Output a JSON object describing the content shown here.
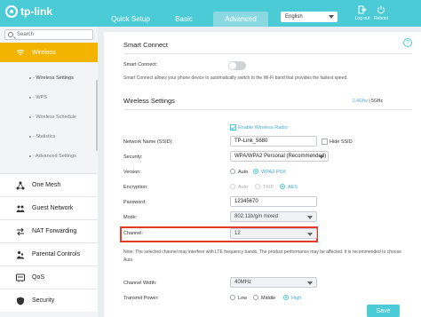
{
  "header": {
    "brand": "tp-link",
    "tabs": [
      {
        "label": "Quick Setup"
      },
      {
        "label": "Basic"
      },
      {
        "label": "Advanced"
      }
    ],
    "language": "English",
    "logout_label": "Log out",
    "reboot_label": "Reboot"
  },
  "sidebar": {
    "search_placeholder": "Search",
    "active_item": {
      "label": "Wireless",
      "icon": "wifi-icon"
    },
    "sub_items": [
      {
        "label": "- Wireless Settings"
      },
      {
        "label": "- WPS"
      },
      {
        "label": "- Wireless Schedule"
      },
      {
        "label": "- Statistics"
      },
      {
        "label": "- Advanced Settings"
      }
    ],
    "items": [
      {
        "label": "One Mesh",
        "icon": "mesh-icon"
      },
      {
        "label": "Guest Network",
        "icon": "guest-network-icon"
      },
      {
        "label": "NAT Forwarding",
        "icon": "nat-forwarding-icon"
      },
      {
        "label": "Parental Controls",
        "icon": "parental-controls-icon"
      },
      {
        "label": "QoS",
        "icon": "qos-icon"
      },
      {
        "label": "Security",
        "icon": "security-icon"
      }
    ]
  },
  "smart_connect": {
    "title": "Smart Connect",
    "label": "Smart Connect:",
    "enabled": false,
    "description": "Smart Connect allows your phone device to automatically switch to the Wi-Fi band that provides the fastest speed."
  },
  "wireless_settings": {
    "title": "Wireless Settings",
    "band_24": "2.4GHz",
    "band_sep": "|",
    "band_5": "5GHz",
    "enable_radio_label": "Enable Wireless Radio",
    "ssid_label": "Network Name (SSID):",
    "ssid_value": "TP-Link_5680",
    "hide_ssid_label": "Hide SSID",
    "security_label": "Security:",
    "security_value": "WPA/WPA2 Personal (Recommended)",
    "version_label": "Version:",
    "version_options": [
      "Auto",
      "WPA2-PSK"
    ],
    "encryption_label": "Encryption:",
    "encryption_options": [
      "Auto",
      "TKIP",
      "AES"
    ],
    "password_label": "Password:",
    "password_value": "12345670",
    "mode_label": "Mode:",
    "mode_value": "802.11b/g/n mixed",
    "channel_label": "Channel:",
    "channel_value": "12",
    "note": "Note: The selected channel may interfere with LTE frequency bands. The product performance may be affected. It is recommended to choose Auto.",
    "channel_width_label": "Channel Width:",
    "channel_width_value": "40MHz",
    "transmit_power_label": "Transmit Power:",
    "transmit_power_options": [
      "Low",
      "Middle",
      "High"
    ]
  },
  "save_label": "Save",
  "help_label": "?",
  "colors": {
    "accent": "#4acbd6",
    "active_nav": "#f3b400",
    "highlight": "#e23b2e"
  }
}
